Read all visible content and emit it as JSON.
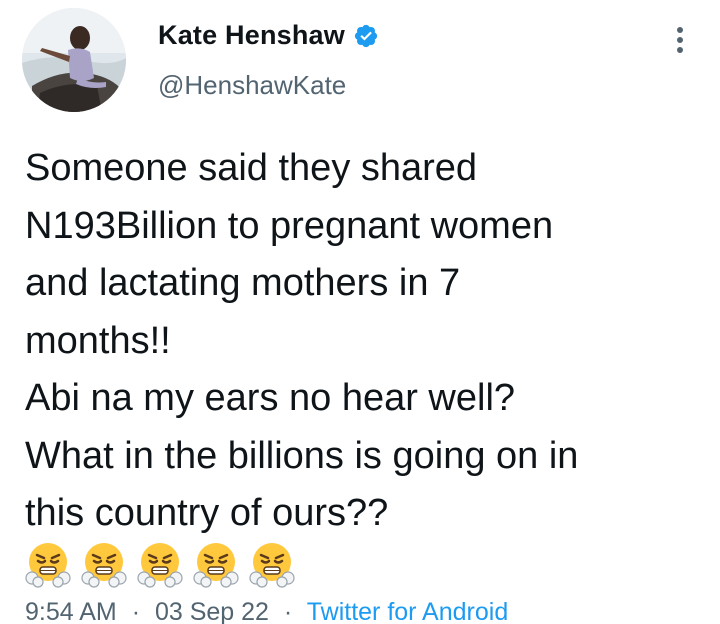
{
  "author": {
    "display_name": "Kate Henshaw",
    "handle": "@HenshawKate",
    "verified": true,
    "avatar_icon": "profile-photo"
  },
  "tweet": {
    "lines": [
      "Someone said they shared",
      "N193Billion to pregnant women",
      "and lactating mothers in 7",
      "months!!",
      "Abi na my ears no hear well?",
      "What in the billions is going on in",
      "this country of ours??"
    ],
    "emojis": [
      "face-with-steam-from-nose",
      "face-with-steam-from-nose",
      "face-with-steam-from-nose",
      "face-with-steam-from-nose",
      "face-with-steam-from-nose"
    ]
  },
  "meta": {
    "time": "9:54 AM",
    "separator": "·",
    "date": "03 Sep 22",
    "source": "Twitter for Android"
  },
  "colors": {
    "verified": "#1d9bf0",
    "link": "#1d9bf0",
    "secondary_text": "#536471"
  }
}
